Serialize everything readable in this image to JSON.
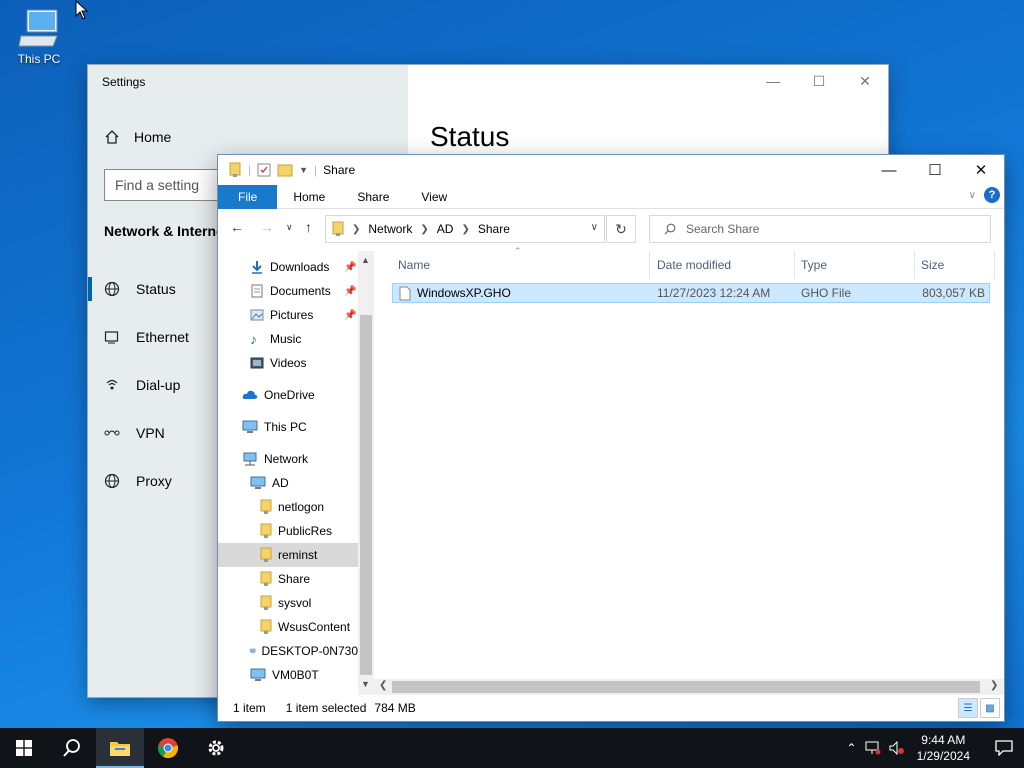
{
  "desktop": {
    "icon_label": "This PC"
  },
  "settings": {
    "title": "Settings",
    "home": "Home",
    "search_placeholder": "Find a setting",
    "section_title": "Network & Internet",
    "page_title": "Status",
    "items": [
      {
        "label": "Status",
        "icon": "globe-icon"
      },
      {
        "label": "Ethernet",
        "icon": "ethernet-icon"
      },
      {
        "label": "Dial-up",
        "icon": "phone-icon"
      },
      {
        "label": "VPN",
        "icon": "vpn-icon"
      },
      {
        "label": "Proxy",
        "icon": "globe-icon"
      }
    ]
  },
  "explorer": {
    "title": "Share",
    "ribbon": {
      "file": "File",
      "home": "Home",
      "share": "Share",
      "view": "View"
    },
    "address": {
      "path": [
        "Network",
        "AD",
        "Share"
      ],
      "search_placeholder": "Search Share"
    },
    "nav": {
      "quick": [
        "Downloads",
        "Documents",
        "Pictures",
        "Music",
        "Videos"
      ],
      "onedrive": "OneDrive",
      "thispc": "This PC",
      "network": "Network",
      "ad": "AD",
      "shares": [
        "netlogon",
        "PublicRes",
        "reminst",
        "Share",
        "sysvol",
        "WsusContent"
      ],
      "computers": [
        "DESKTOP-0N730",
        "VM0B0T"
      ]
    },
    "columns": {
      "name": "Name",
      "date": "Date modified",
      "type": "Type",
      "size": "Size"
    },
    "files": [
      {
        "name": "WindowsXP.GHO",
        "date": "11/27/2023 12:24 AM",
        "type": "GHO File",
        "size": "803,057 KB"
      }
    ],
    "status": {
      "count": "1 item",
      "selected": "1 item selected",
      "size": "784 MB"
    }
  },
  "taskbar": {
    "time": "9:44 AM",
    "date": "1/29/2024"
  }
}
